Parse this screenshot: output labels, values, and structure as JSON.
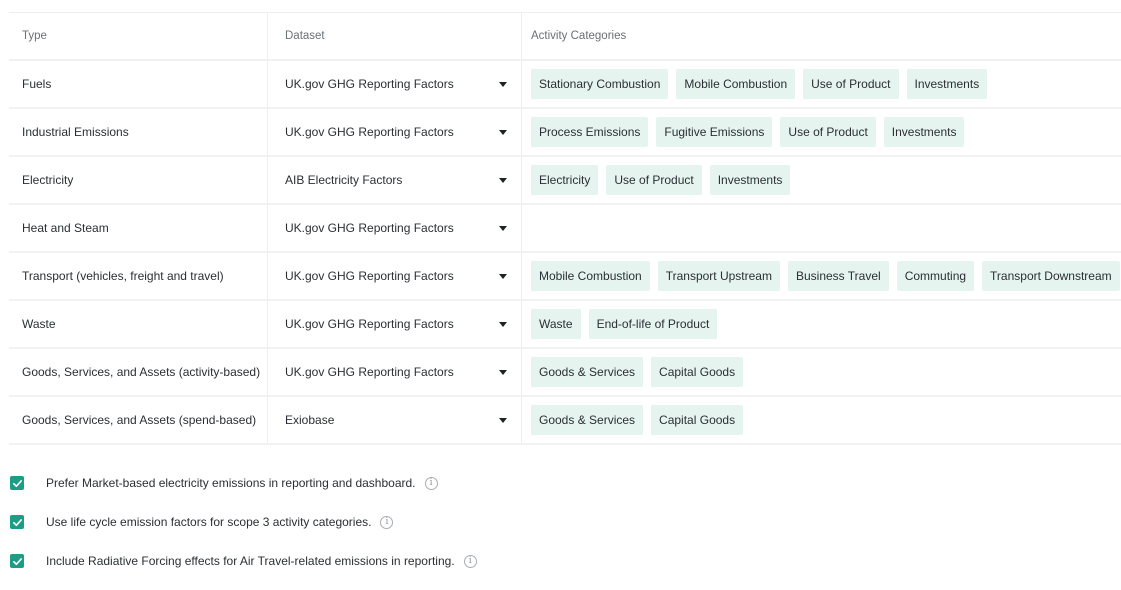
{
  "table": {
    "headers": {
      "type": "Type",
      "dataset": "Dataset",
      "categories": "Activity Categories"
    },
    "rows": [
      {
        "type": "Fuels",
        "dataset": "UK.gov GHG Reporting Factors",
        "categories": [
          "Stationary Combustion",
          "Mobile Combustion",
          "Use of Product",
          "Investments"
        ]
      },
      {
        "type": "Industrial Emissions",
        "dataset": "UK.gov GHG Reporting Factors",
        "categories": [
          "Process Emissions",
          "Fugitive Emissions",
          "Use of Product",
          "Investments"
        ]
      },
      {
        "type": "Electricity",
        "dataset": "AIB Electricity Factors",
        "categories": [
          "Electricity",
          "Use of Product",
          "Investments"
        ]
      },
      {
        "type": "Heat and Steam",
        "dataset": "UK.gov GHG Reporting Factors",
        "categories": []
      },
      {
        "type": "Transport (vehicles, freight and travel)",
        "dataset": "UK.gov GHG Reporting Factors",
        "categories": [
          "Mobile Combustion",
          "Transport Upstream",
          "Business Travel",
          "Commuting",
          "Transport Downstream"
        ]
      },
      {
        "type": "Waste",
        "dataset": "UK.gov GHG Reporting Factors",
        "categories": [
          "Waste",
          "End-of-life of Product"
        ]
      },
      {
        "type": "Goods, Services, and Assets (activity-based)",
        "dataset": "UK.gov GHG Reporting Factors",
        "categories": [
          "Goods & Services",
          "Capital Goods"
        ]
      },
      {
        "type": "Goods, Services, and Assets (spend-based)",
        "dataset": "Exiobase",
        "categories": [
          "Goods & Services",
          "Capital Goods"
        ]
      }
    ]
  },
  "options": [
    {
      "label": "Prefer Market-based electricity emissions in reporting and dashboard.",
      "checked": true
    },
    {
      "label": "Use life cycle emission factors for scope 3 activity categories.",
      "checked": true
    },
    {
      "label": "Include Radiative Forcing effects for Air Travel-related emissions in reporting.",
      "checked": true
    }
  ],
  "icons": {
    "dropdown": "caret-down-icon",
    "checkbox": "check-icon",
    "info": "info-icon"
  },
  "colors": {
    "chip_bg": "#e6f4ef",
    "checkbox": "#1b9e85"
  }
}
